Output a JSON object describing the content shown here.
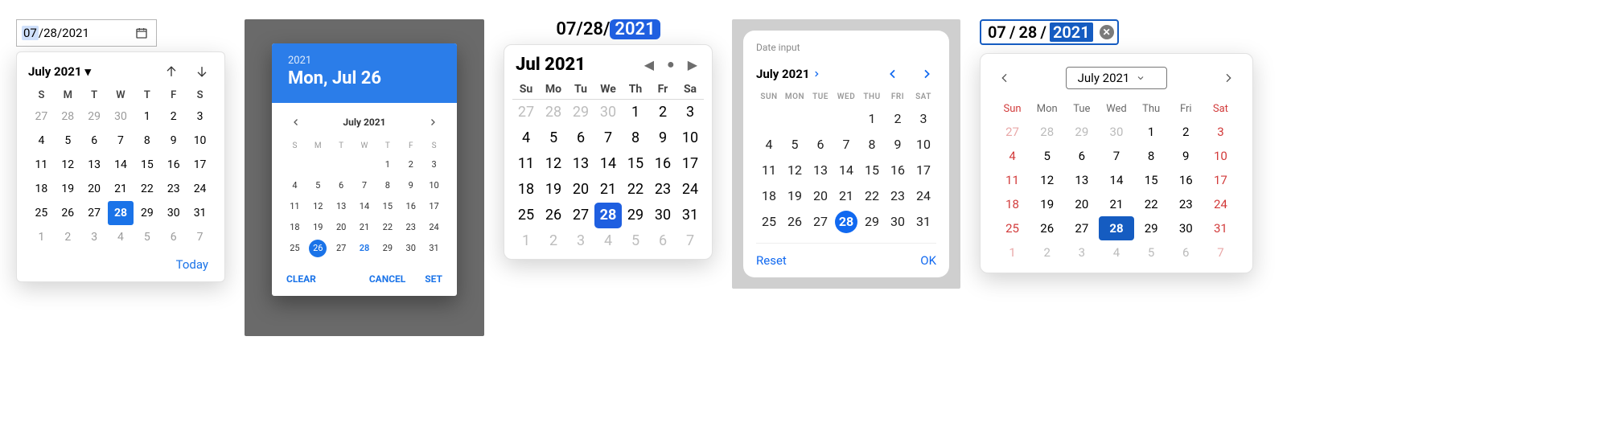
{
  "dows_short1": [
    "S",
    "M",
    "T",
    "W",
    "T",
    "F",
    "S"
  ],
  "dows_short2": [
    "Su",
    "Mo",
    "Tu",
    "We",
    "Th",
    "Fr",
    "Sa"
  ],
  "dows_upper": [
    "SUN",
    "MON",
    "TUE",
    "WED",
    "THU",
    "FRI",
    "SAT"
  ],
  "dows_title": [
    "Sun",
    "Mon",
    "Tue",
    "Wed",
    "Thu",
    "Fri",
    "Sat"
  ],
  "chrome": {
    "input": {
      "mm": "07",
      "sep": "/",
      "dd": "28",
      "yy": "2021"
    },
    "title": "July 2021",
    "today": "Today",
    "grid": [
      [
        "27",
        "o"
      ],
      [
        "28",
        "o"
      ],
      [
        "29",
        "o"
      ],
      [
        "30",
        "o"
      ],
      [
        "1",
        ""
      ],
      [
        "2",
        ""
      ],
      [
        "3",
        ""
      ],
      [
        "4",
        ""
      ],
      [
        "5",
        ""
      ],
      [
        "6",
        ""
      ],
      [
        "7",
        ""
      ],
      [
        "8",
        ""
      ],
      [
        "9",
        ""
      ],
      [
        "10",
        ""
      ],
      [
        "11",
        ""
      ],
      [
        "12",
        ""
      ],
      [
        "13",
        ""
      ],
      [
        "14",
        ""
      ],
      [
        "15",
        ""
      ],
      [
        "16",
        ""
      ],
      [
        "17",
        ""
      ],
      [
        "18",
        ""
      ],
      [
        "19",
        ""
      ],
      [
        "20",
        ""
      ],
      [
        "21",
        ""
      ],
      [
        "22",
        ""
      ],
      [
        "23",
        ""
      ],
      [
        "24",
        ""
      ],
      [
        "25",
        ""
      ],
      [
        "26",
        ""
      ],
      [
        "27",
        ""
      ],
      [
        "28",
        "s"
      ],
      [
        "29",
        ""
      ],
      [
        "30",
        ""
      ],
      [
        "31",
        ""
      ],
      [
        "1",
        "o"
      ],
      [
        "2",
        "o"
      ],
      [
        "3",
        "o"
      ],
      [
        "4",
        "o"
      ],
      [
        "5",
        "o"
      ],
      [
        "6",
        "o"
      ],
      [
        "7",
        "o"
      ]
    ]
  },
  "material": {
    "year": "2021",
    "date_text": "Mon, Jul 26",
    "title": "July 2021",
    "actions": {
      "clear": "CLEAR",
      "cancel": "CANCEL",
      "set": "SET"
    },
    "grid": [
      [
        "",
        "e"
      ],
      [
        "",
        "e"
      ],
      [
        "",
        "e"
      ],
      [
        "",
        "e"
      ],
      [
        "1",
        ""
      ],
      [
        "2",
        ""
      ],
      [
        "3",
        ""
      ],
      [
        "4",
        ""
      ],
      [
        "5",
        ""
      ],
      [
        "6",
        ""
      ],
      [
        "7",
        ""
      ],
      [
        "8",
        ""
      ],
      [
        "9",
        ""
      ],
      [
        "10",
        ""
      ],
      [
        "11",
        ""
      ],
      [
        "12",
        ""
      ],
      [
        "13",
        ""
      ],
      [
        "14",
        ""
      ],
      [
        "15",
        ""
      ],
      [
        "16",
        ""
      ],
      [
        "17",
        ""
      ],
      [
        "18",
        ""
      ],
      [
        "19",
        ""
      ],
      [
        "20",
        ""
      ],
      [
        "21",
        ""
      ],
      [
        "22",
        ""
      ],
      [
        "23",
        ""
      ],
      [
        "24",
        ""
      ],
      [
        "25",
        ""
      ],
      [
        "26",
        "s"
      ],
      [
        "27",
        ""
      ],
      [
        "28",
        "t"
      ],
      [
        "29",
        ""
      ],
      [
        "30",
        ""
      ],
      [
        "31",
        ""
      ]
    ]
  },
  "safari": {
    "input": {
      "mm": "07",
      "dd": "28",
      "yy": "2021",
      "sep": "/"
    },
    "title": "Jul 2021",
    "grid": [
      [
        "27",
        "o"
      ],
      [
        "28",
        "o"
      ],
      [
        "29",
        "o"
      ],
      [
        "30",
        "o"
      ],
      [
        "1",
        ""
      ],
      [
        "2",
        ""
      ],
      [
        "3",
        ""
      ],
      [
        "4",
        ""
      ],
      [
        "5",
        ""
      ],
      [
        "6",
        ""
      ],
      [
        "7",
        ""
      ],
      [
        "8",
        ""
      ],
      [
        "9",
        ""
      ],
      [
        "10",
        ""
      ],
      [
        "11",
        ""
      ],
      [
        "12",
        ""
      ],
      [
        "13",
        ""
      ],
      [
        "14",
        ""
      ],
      [
        "15",
        ""
      ],
      [
        "16",
        ""
      ],
      [
        "17",
        ""
      ],
      [
        "18",
        ""
      ],
      [
        "19",
        ""
      ],
      [
        "20",
        ""
      ],
      [
        "21",
        ""
      ],
      [
        "22",
        ""
      ],
      [
        "23",
        ""
      ],
      [
        "24",
        ""
      ],
      [
        "25",
        ""
      ],
      [
        "26",
        ""
      ],
      [
        "27",
        ""
      ],
      [
        "28",
        "s"
      ],
      [
        "29",
        ""
      ],
      [
        "30",
        ""
      ],
      [
        "31",
        ""
      ],
      [
        "1",
        "o"
      ],
      [
        "2",
        "o"
      ],
      [
        "3",
        "o"
      ],
      [
        "4",
        "o"
      ],
      [
        "5",
        "o"
      ],
      [
        "6",
        "o"
      ],
      [
        "7",
        "o"
      ]
    ]
  },
  "ios": {
    "label": "Date input",
    "title": "July 2021",
    "actions": {
      "reset": "Reset",
      "ok": "OK"
    },
    "grid": [
      [
        "",
        "e"
      ],
      [
        "",
        "e"
      ],
      [
        "",
        "e"
      ],
      [
        "",
        "e"
      ],
      [
        "1",
        ""
      ],
      [
        "2",
        ""
      ],
      [
        "3",
        ""
      ],
      [
        "4",
        ""
      ],
      [
        "5",
        ""
      ],
      [
        "6",
        ""
      ],
      [
        "7",
        ""
      ],
      [
        "8",
        ""
      ],
      [
        "9",
        ""
      ],
      [
        "10",
        ""
      ],
      [
        "11",
        ""
      ],
      [
        "12",
        ""
      ],
      [
        "13",
        ""
      ],
      [
        "14",
        ""
      ],
      [
        "15",
        ""
      ],
      [
        "16",
        ""
      ],
      [
        "17",
        ""
      ],
      [
        "18",
        ""
      ],
      [
        "19",
        ""
      ],
      [
        "20",
        ""
      ],
      [
        "21",
        ""
      ],
      [
        "22",
        ""
      ],
      [
        "23",
        ""
      ],
      [
        "24",
        ""
      ],
      [
        "25",
        ""
      ],
      [
        "26",
        ""
      ],
      [
        "27",
        ""
      ],
      [
        "28",
        "s"
      ],
      [
        "29",
        ""
      ],
      [
        "30",
        ""
      ],
      [
        "31",
        ""
      ]
    ]
  },
  "fluent": {
    "input": {
      "mm": "07",
      "dd": "28",
      "yy": "2021",
      "sep": " / "
    },
    "title": "July 2021",
    "grid": [
      [
        "27",
        "o we"
      ],
      [
        "28",
        "o"
      ],
      [
        "29",
        "o"
      ],
      [
        "30",
        "o"
      ],
      [
        "1",
        ""
      ],
      [
        "2",
        ""
      ],
      [
        "3",
        "we"
      ],
      [
        "4",
        "we"
      ],
      [
        "5",
        ""
      ],
      [
        "6",
        ""
      ],
      [
        "7",
        ""
      ],
      [
        "8",
        ""
      ],
      [
        "9",
        ""
      ],
      [
        "10",
        "we"
      ],
      [
        "11",
        "we"
      ],
      [
        "12",
        ""
      ],
      [
        "13",
        ""
      ],
      [
        "14",
        ""
      ],
      [
        "15",
        ""
      ],
      [
        "16",
        ""
      ],
      [
        "17",
        "we"
      ],
      [
        "18",
        "we"
      ],
      [
        "19",
        ""
      ],
      [
        "20",
        ""
      ],
      [
        "21",
        ""
      ],
      [
        "22",
        ""
      ],
      [
        "23",
        ""
      ],
      [
        "24",
        "we"
      ],
      [
        "25",
        "we"
      ],
      [
        "26",
        ""
      ],
      [
        "27",
        ""
      ],
      [
        "28",
        "s"
      ],
      [
        "29",
        ""
      ],
      [
        "30",
        ""
      ],
      [
        "31",
        "we"
      ],
      [
        "1",
        "o we"
      ],
      [
        "2",
        "o"
      ],
      [
        "3",
        "o"
      ],
      [
        "4",
        "o"
      ],
      [
        "5",
        "o"
      ],
      [
        "6",
        "o"
      ],
      [
        "7",
        "o we"
      ]
    ]
  }
}
